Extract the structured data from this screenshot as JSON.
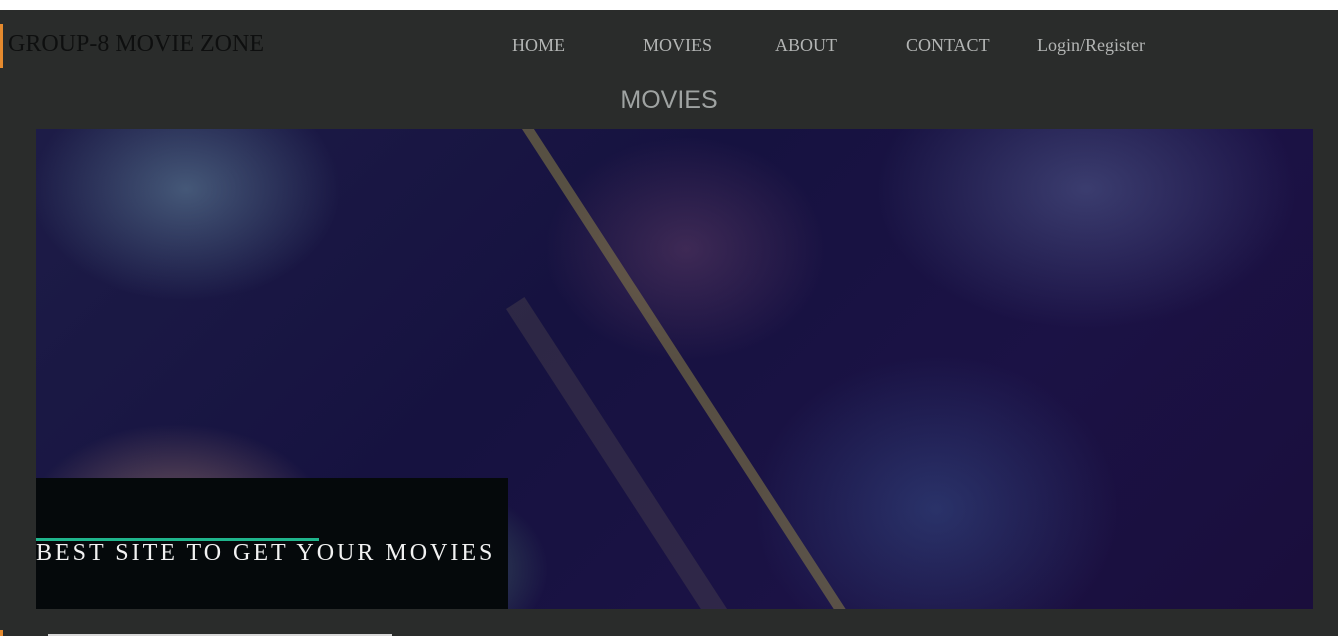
{
  "brand": {
    "title": "GROUP-8 MOVIE ZONE",
    "accent_color": "#e58a2e"
  },
  "nav": {
    "items": [
      {
        "label": "HOME"
      },
      {
        "label": "MOVIES"
      },
      {
        "label": "ABOUT"
      },
      {
        "label": "CONTACT"
      },
      {
        "label": "Login/Register"
      }
    ]
  },
  "main": {
    "section_title": "MOVIES",
    "hero": {
      "image": "movie-couple-photo",
      "caption": "BEST SITE TO GET YOUR MOVIES",
      "caption_bar_color": "#1fb58c"
    }
  }
}
